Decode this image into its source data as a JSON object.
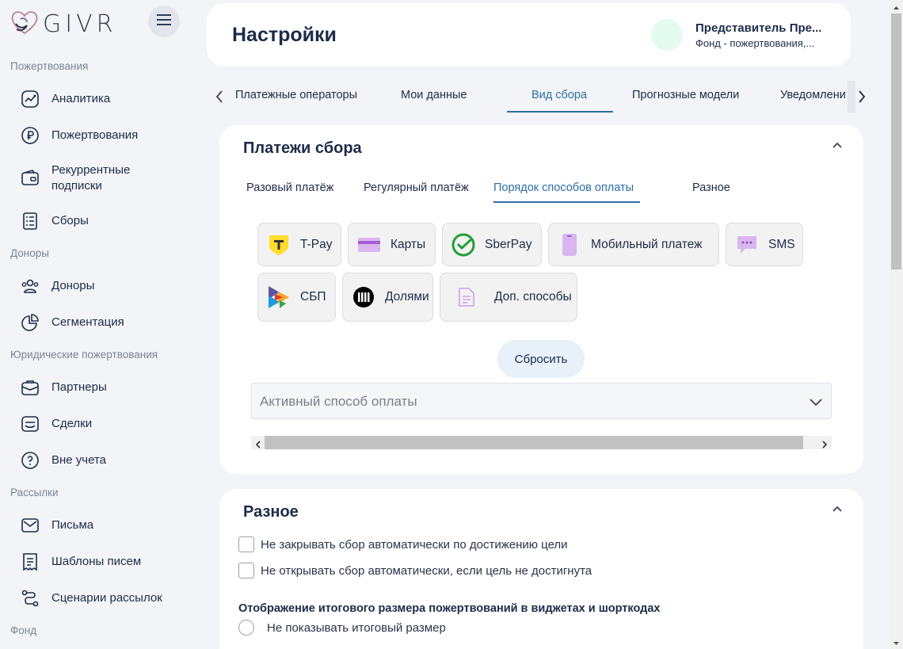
{
  "logo": {
    "text": "GIVR"
  },
  "sidebar": {
    "sections": [
      {
        "title": "Пожертвования"
      },
      {
        "title": "Доноры"
      },
      {
        "title": "Юридические пожертвования"
      },
      {
        "title": "Рассылки"
      },
      {
        "title": "Фонд"
      }
    ],
    "items": [
      {
        "label": "Аналитика",
        "icon": "analytics-icon"
      },
      {
        "label": "Пожертвования",
        "icon": "ruble-icon"
      },
      {
        "label": "Рекуррентные подписки",
        "icon": "wallet-icon"
      },
      {
        "label": "Сборы",
        "icon": "list-icon"
      },
      {
        "label": "Доноры",
        "icon": "users-icon"
      },
      {
        "label": "Сегментация",
        "icon": "pie-chart-icon"
      },
      {
        "label": "Партнеры",
        "icon": "briefcase-icon"
      },
      {
        "label": "Сделки",
        "icon": "deal-icon"
      },
      {
        "label": "Вне учета",
        "icon": "question-icon"
      },
      {
        "label": "Письма",
        "icon": "mail-icon"
      },
      {
        "label": "Шаблоны писем",
        "icon": "template-icon"
      },
      {
        "label": "Сценарии рассылок",
        "icon": "flow-icon"
      }
    ]
  },
  "header": {
    "title": "Настройки",
    "user_name": "Представитель Пре...",
    "user_org": "Фонд - пожертвования,..."
  },
  "tabs": {
    "items": [
      "Платежные операторы",
      "Мои данные",
      "Вид сбора",
      "Прогнозные модели",
      "Уведомлени"
    ],
    "active": "Вид сбора"
  },
  "payments_card": {
    "title": "Платежи сбора",
    "subtabs": [
      "Разовый платёж",
      "Регулярный платёж",
      "Порядок способов оплаты",
      "Разное"
    ],
    "active_subtab": "Порядок способов оплаты",
    "methods": [
      {
        "label": "T-Pay",
        "icon": "tpay-icon"
      },
      {
        "label": "Карты",
        "icon": "card-icon"
      },
      {
        "label": "SberPay",
        "icon": "sberpay-icon"
      },
      {
        "label": "Мобильный платеж",
        "icon": "mobile-icon"
      },
      {
        "label": "SMS",
        "icon": "sms-icon"
      },
      {
        "label": "СБП",
        "icon": "sbp-icon"
      },
      {
        "label": "Долями",
        "icon": "dolyami-icon"
      },
      {
        "label": "Доп. способы",
        "icon": "document-icon"
      }
    ],
    "reset_label": "Сбросить",
    "select_placeholder": "Активный способ оплаты"
  },
  "misc_card": {
    "title": "Разное",
    "checkboxes": [
      {
        "label": "Не закрывать сбор автоматически по достижению цели",
        "checked": false
      },
      {
        "label": "Не открывать сбор автоматически, если цель не достигнута",
        "checked": false
      }
    ],
    "display_heading": "Отображение итогового размера пожертвований в виджетах и шорткодах",
    "radio_label": "Не показывать итоговый размер"
  },
  "colors": {
    "accent": "#2e6ea6",
    "text": "#1d2b48",
    "background": "#f2f4f7",
    "card": "#ffffff"
  }
}
